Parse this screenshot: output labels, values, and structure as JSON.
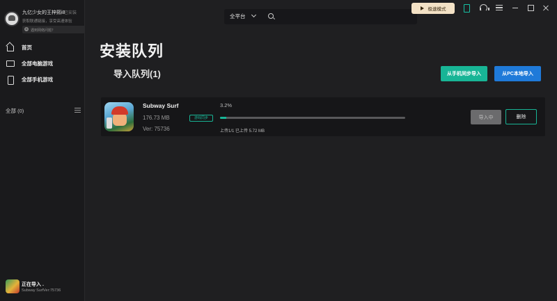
{
  "user": {
    "name": "九亿少女的王梓熙i8",
    "tag": "已安装",
    "subtitle": "获取联通链接，享受高速体验",
    "notice": "遇到网络问题？"
  },
  "nav": {
    "items": [
      {
        "label": "首页",
        "icon": "home-icon"
      },
      {
        "label": "全部电脑游戏",
        "icon": "monitor-icon"
      },
      {
        "label": "全部手机游戏",
        "icon": "phone-icon"
      }
    ]
  },
  "library": {
    "all_label": "全部 (0)"
  },
  "import_status": {
    "title": "正在导入 .",
    "subtitle": "Subway SurfVer:75736"
  },
  "topbar": {
    "platform": "全平台",
    "speed_mode": "极速模式"
  },
  "main": {
    "title": "安装队列",
    "queue_title": "导入队列(1)",
    "sync_button": "从手机同步导入",
    "local_button": "从PC本地导入"
  },
  "queue": {
    "item": {
      "name": "Subway Surf",
      "size": "176.73 MB",
      "version": "Ver: 75736",
      "badge": "游戏同步",
      "percent": "3.2%",
      "progress": 0.032,
      "upload_status": "上传1/1  已上传 5.72 MB",
      "importing_button": "导入中",
      "delete_button": "删除"
    }
  },
  "colors": {
    "accent": "#18b596",
    "blue": "#1f7ad9",
    "speed_bg": "#f4e2c6"
  }
}
